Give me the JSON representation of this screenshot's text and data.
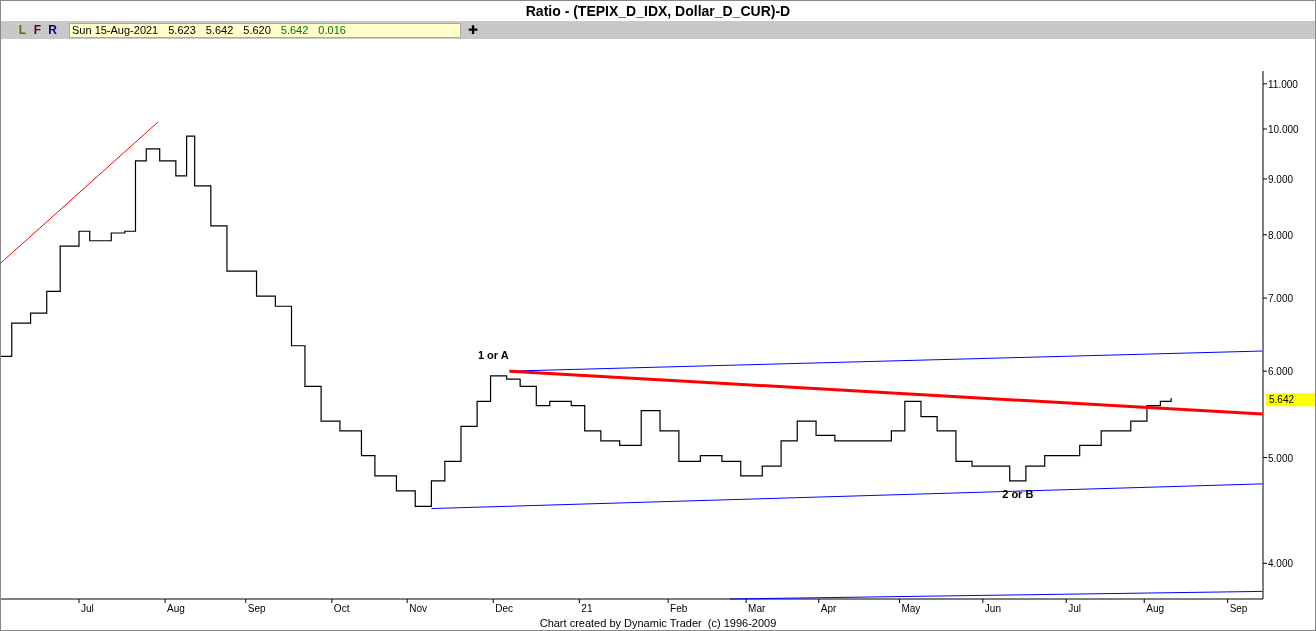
{
  "window": {
    "title": "Ratio - (TEPIX_D_IDX, Dollar_D_CUR)-D"
  },
  "toolbar": {
    "buttons": [
      {
        "label": "L",
        "color": "#6b6b00"
      },
      {
        "label": "F",
        "color": "#7a0000"
      },
      {
        "label": "R",
        "color": "#000080"
      }
    ],
    "info": [
      {
        "kind": "date",
        "text": "Sun 15-Aug-2021"
      },
      {
        "kind": "open",
        "text": "5.623"
      },
      {
        "kind": "high",
        "text": "5.642"
      },
      {
        "kind": "low",
        "text": "5.620"
      },
      {
        "kind": "close",
        "text": "5.642"
      },
      {
        "kind": "change",
        "text": "0.016"
      }
    ],
    "add_button": "✚"
  },
  "chart": {
    "price_marker": "5.642",
    "y_axis_labels": [
      "11.000",
      "10.000",
      "9.000",
      "8.000",
      "7.000",
      "6.000",
      "5.000",
      "4.000"
    ],
    "x_axis_labels": [
      "Jul",
      "Aug",
      "Sep",
      "Oct",
      "Nov",
      "Dec",
      "21",
      "Feb",
      "Mar",
      "Apr",
      "May",
      "Jun",
      "Jul",
      "Aug",
      "Sep"
    ],
    "wave_labels": [
      "1 or A",
      "2 or B"
    ]
  },
  "footer": "Chart created by Dynamic Trader  (c) 1996-2009"
}
